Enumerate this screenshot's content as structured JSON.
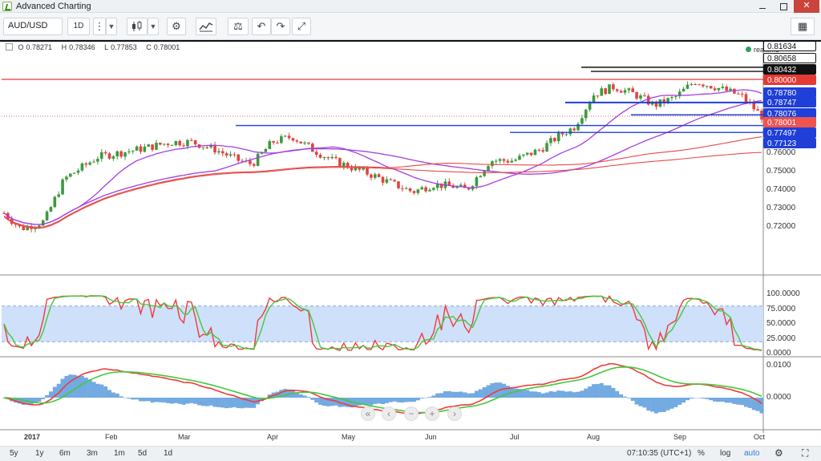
{
  "window": {
    "title": "Advanced Charting",
    "buttons": {
      "minimize": "minimize",
      "maximize": "maximize",
      "close": "✕"
    }
  },
  "toolbar": {
    "symbol": "AUD/USD",
    "interval": "1D",
    "icons": [
      "menu-dots-icon",
      "candlestick-icon",
      "settings-gear-icon",
      "indicators-icon",
      "compare-scales-icon",
      "undo-icon",
      "redo-icon",
      "fullscreen-icon",
      "layout-grid-icon"
    ]
  },
  "legend": {
    "o_label": "O",
    "o_value": "0.78271",
    "h_label": "H",
    "h_value": "0.78346",
    "l_label": "L",
    "l_value": "0.77853",
    "c_label": "C",
    "c_value": "0.78001"
  },
  "realtime": "realtime",
  "price_axis": {
    "ticks": [
      "0.76000",
      "0.75000",
      "0.74000",
      "0.73000",
      "0.72000"
    ],
    "labels": [
      {
        "text": "0.81634",
        "bg": "#ffffff",
        "fg": "#111111",
        "border": "#111111"
      },
      {
        "text": "0.80658",
        "bg": "#ffffff",
        "fg": "#111111",
        "border": "#111111"
      },
      {
        "text": "0.80432",
        "bg": "#111111",
        "fg": "#ffffff",
        "border": "#111111"
      },
      {
        "text": "0.80000",
        "bg": "#e53935",
        "fg": "#ffffff",
        "border": "#e53935"
      },
      {
        "text": "0.78780",
        "bg": "#1f3fd8",
        "fg": "#ffffff",
        "border": "#1f3fd8"
      },
      {
        "text": "0.78747",
        "bg": "#1f3fd8",
        "fg": "#ffffff",
        "border": "#1f3fd8"
      },
      {
        "text": "0.78076",
        "bg": "#1f3fd8",
        "fg": "#ffffff",
        "border": "#1f3fd8"
      },
      {
        "text": "0.78001",
        "bg": "#ef5350",
        "fg": "#ffffff",
        "border": "#ef5350"
      },
      {
        "text": "0.77497",
        "bg": "#1f3fd8",
        "fg": "#ffffff",
        "border": "#1f3fd8"
      },
      {
        "text": "0.77123",
        "bg": "#1f3fd8",
        "fg": "#ffffff",
        "border": "#1f3fd8"
      }
    ]
  },
  "osc_axis": {
    "ticks": [
      "100.0000",
      "75.0000",
      "50.0000",
      "25.0000",
      "0.0000"
    ]
  },
  "macd_axis": {
    "ticks": [
      "0.0100",
      "0.0000"
    ]
  },
  "time_axis": [
    "2017",
    "Feb",
    "Mar",
    "Apr",
    "May",
    "Jun",
    "Jul",
    "Aug",
    "Sep",
    "Oct"
  ],
  "bottom_bar": {
    "periods": [
      "5y",
      "1y",
      "6m",
      "3m",
      "1m",
      "5d",
      "1d"
    ],
    "clock": "07:10:35 (UTC+1)",
    "percent": "%",
    "log": "log",
    "auto": "auto"
  },
  "nav_buttons": [
    "«",
    "‹",
    "−",
    "+",
    "›"
  ],
  "colors": {
    "up_candle": "#3c9a3c",
    "down_candle": "#e0443f",
    "resistance_line": "#111111",
    "support_line": "#1f3fd8",
    "round_level": "#e53935",
    "ma_purple": "#a53ee0",
    "ma_red": "#e64a4a",
    "stoch_fast": "#ef3b3b",
    "stoch_slow": "#44c83a",
    "osc_band": "#cfe0fb",
    "macd_hist": "#5b9bdc"
  }
}
